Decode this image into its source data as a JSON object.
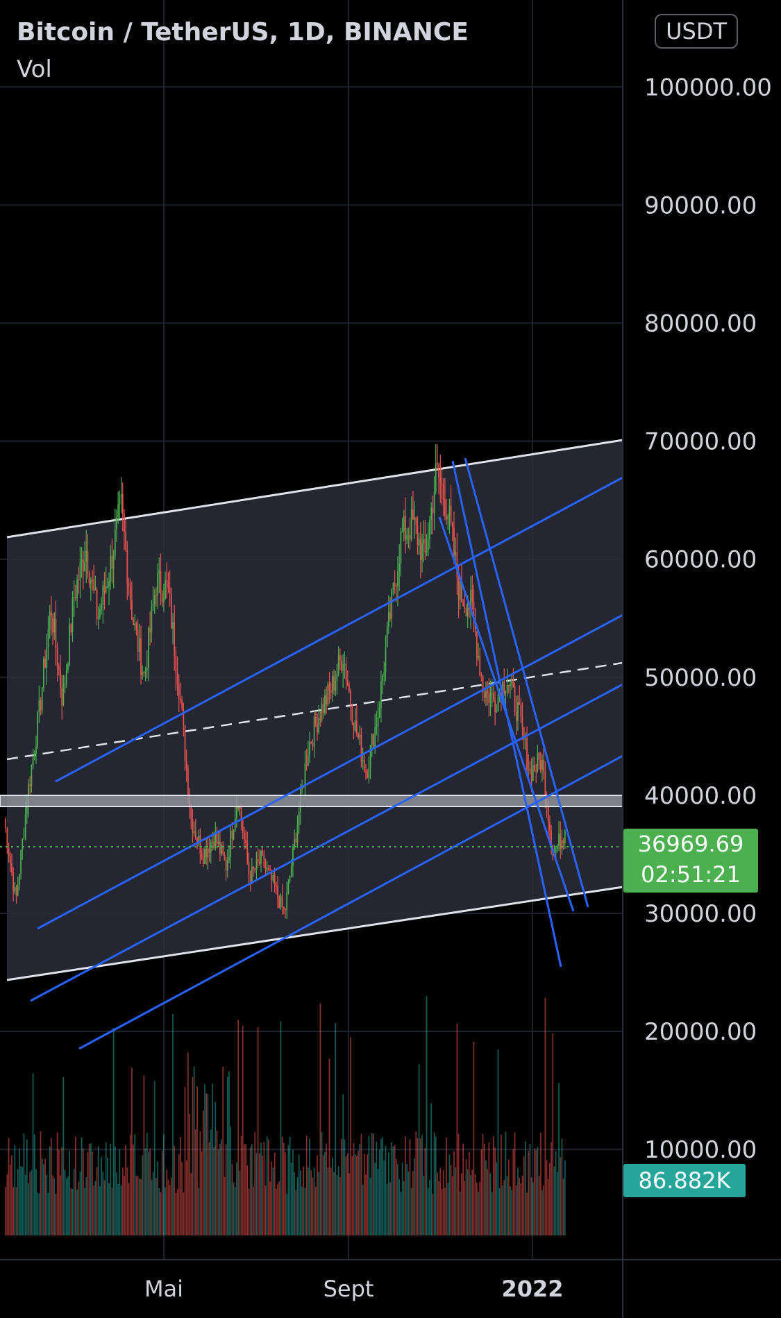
{
  "header": {
    "title": "Bitcoin / TetherUS, 1D, BINANCE",
    "indicator": "Vol",
    "currency": "USDT"
  },
  "price_axis": {
    "labels": [
      "100000.00",
      "90000.00",
      "80000.00",
      "70000.00",
      "60000.00",
      "50000.00",
      "40000.00",
      "30000.00",
      "20000.00",
      "10000.00"
    ]
  },
  "time_axis": {
    "labels": [
      "Mai",
      "Sept",
      "2022"
    ]
  },
  "last_price": {
    "value": "36969.69",
    "countdown": "02:51:21"
  },
  "volume": {
    "value": "86.882K"
  },
  "colors": {
    "up": "#26a69a",
    "candle_up": "#4caf50",
    "down": "#ef5350",
    "trendline": "#2962ff",
    "channel": "#ffffff",
    "background": "#000000"
  },
  "chart_data": {
    "type": "candlestick",
    "title": "Bitcoin / TetherUS, 1D, BINANCE",
    "ylim": [
      16000,
      104000
    ],
    "y_ticks": [
      100000,
      90000,
      80000,
      70000,
      60000,
      50000,
      40000,
      30000,
      20000,
      10000
    ],
    "x_ticks": [
      "Mai",
      "Sept",
      "2022"
    ],
    "last_price": 36969.69,
    "support_zone": [
      40800,
      41600
    ],
    "price_path": [
      {
        "date": "Feb",
        "price": 38000
      },
      {
        "date": "Feb",
        "price": 31000
      },
      {
        "date": "Feb",
        "price": 40000
      },
      {
        "date": "Feb",
        "price": 47000
      },
      {
        "date": "Feb",
        "price": 56000
      },
      {
        "date": "Mar",
        "price": 48000
      },
      {
        "date": "Mar",
        "price": 57000
      },
      {
        "date": "Mar",
        "price": 61000
      },
      {
        "date": "Mar",
        "price": 55000
      },
      {
        "date": "Apr",
        "price": 59000
      },
      {
        "date": "Apr",
        "price": 64500
      },
      {
        "date": "Apr",
        "price": 55000
      },
      {
        "date": "Apr",
        "price": 50000
      },
      {
        "date": "Apr",
        "price": 58000
      },
      {
        "date": "Mai",
        "price": 57500
      },
      {
        "date": "Mai",
        "price": 49000
      },
      {
        "date": "Mai",
        "price": 38000
      },
      {
        "date": "Mai",
        "price": 35000
      },
      {
        "date": "Jun",
        "price": 36500
      },
      {
        "date": "Jun",
        "price": 34000
      },
      {
        "date": "Jun",
        "price": 40000
      },
      {
        "date": "Jun",
        "price": 33000
      },
      {
        "date": "Jul",
        "price": 34500
      },
      {
        "date": "Jul",
        "price": 32500
      },
      {
        "date": "Jul",
        "price": 30000
      },
      {
        "date": "Jul",
        "price": 37000
      },
      {
        "date": "Aug",
        "price": 44000
      },
      {
        "date": "Aug",
        "price": 47000
      },
      {
        "date": "Aug",
        "price": 49000
      },
      {
        "date": "Sept",
        "price": 52000
      },
      {
        "date": "Sept",
        "price": 46000
      },
      {
        "date": "Sept",
        "price": 42000
      },
      {
        "date": "Sept",
        "price": 47000
      },
      {
        "date": "Oct",
        "price": 55000
      },
      {
        "date": "Oct",
        "price": 62000
      },
      {
        "date": "Oct",
        "price": 63000
      },
      {
        "date": "Oct",
        "price": 60000
      },
      {
        "date": "Nov",
        "price": 67500
      },
      {
        "date": "Nov",
        "price": 64000
      },
      {
        "date": "Nov",
        "price": 57000
      },
      {
        "date": "Nov",
        "price": 56000
      },
      {
        "date": "Dec",
        "price": 49000
      },
      {
        "date": "Dec",
        "price": 48000
      },
      {
        "date": "Dec",
        "price": 50000
      },
      {
        "date": "Dec",
        "price": 47000
      },
      {
        "date": "2022",
        "price": 42000
      },
      {
        "date": "2022",
        "price": 43000
      },
      {
        "date": "2022",
        "price": 35000
      },
      {
        "date": "2022",
        "price": 36969.69
      }
    ]
  }
}
